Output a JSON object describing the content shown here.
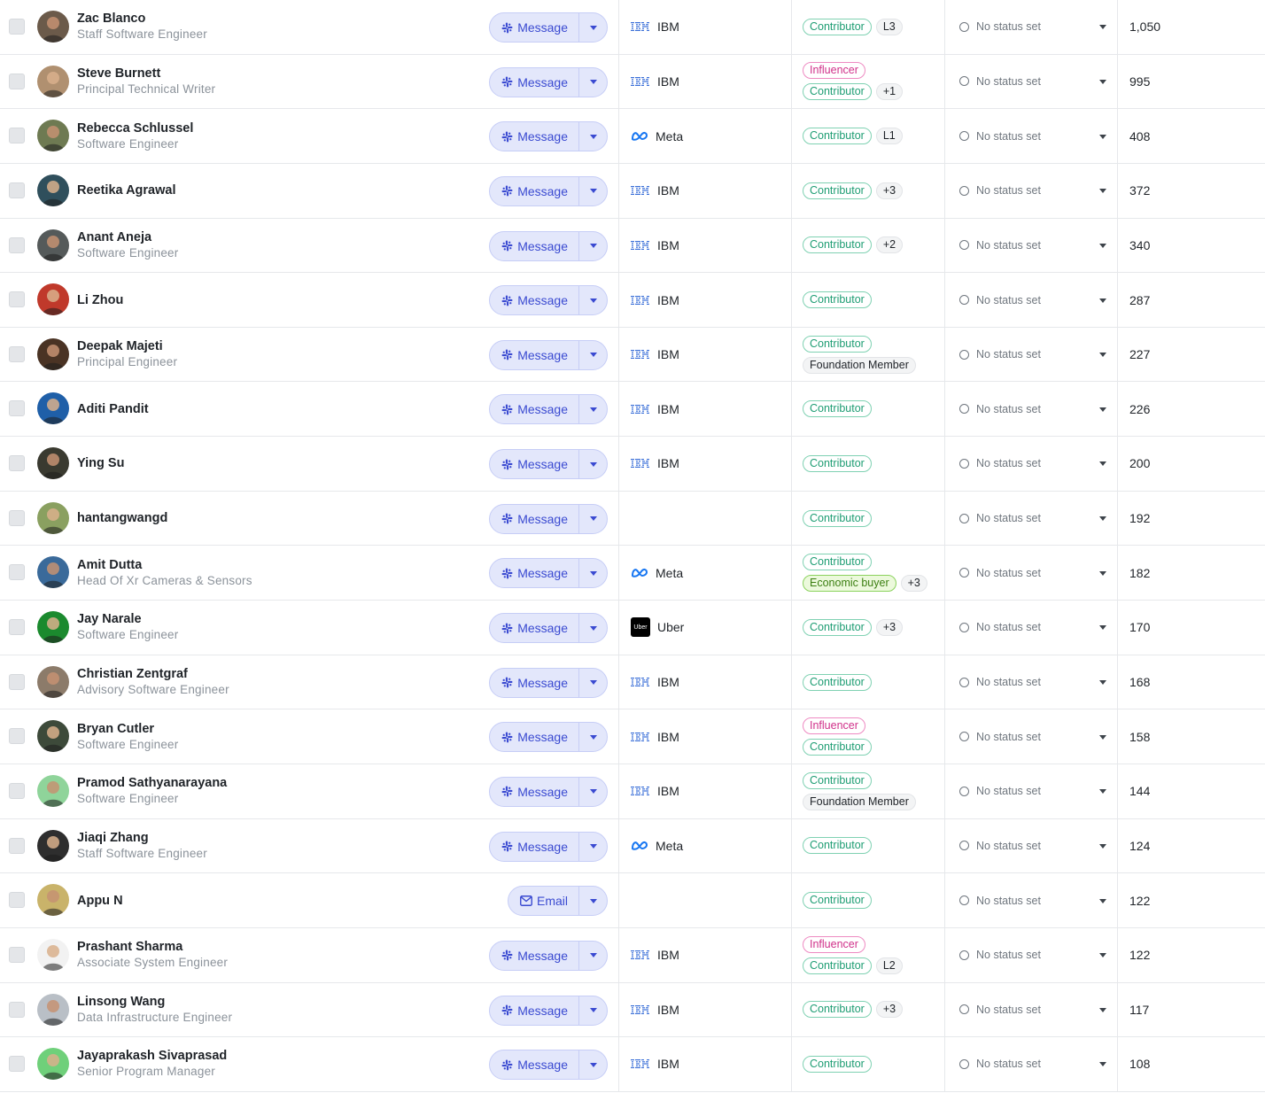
{
  "rows": [
    {
      "name": "Zac Blanco",
      "title": "Staff Software Engineer",
      "action": "Message",
      "company": "IBM",
      "tag_lines": [
        [
          {
            "text": "Contributor",
            "style": "green"
          },
          {
            "text": "L3",
            "style": "gray"
          }
        ]
      ],
      "status": "No status set",
      "score": "1,050",
      "avatar_color": "#6b5a4a"
    },
    {
      "name": "Steve Burnett",
      "title": "Principal Technical Writer",
      "action": "Message",
      "company": "IBM",
      "tag_lines": [
        [
          {
            "text": "Influencer",
            "style": "pink"
          }
        ],
        [
          {
            "text": "Contributor",
            "style": "green"
          },
          {
            "text": "+1",
            "style": "gray"
          }
        ]
      ],
      "status": "No status set",
      "score": "995",
      "avatar_color": "#b09070"
    },
    {
      "name": "Rebecca Schlussel",
      "title": "Software Engineer",
      "action": "Message",
      "company": "Meta",
      "tag_lines": [
        [
          {
            "text": "Contributor",
            "style": "green"
          },
          {
            "text": "L1",
            "style": "gray"
          }
        ]
      ],
      "status": "No status set",
      "score": "408",
      "avatar_color": "#6e7a52"
    },
    {
      "name": "Reetika Agrawal",
      "title": "",
      "action": "Message",
      "company": "IBM",
      "tag_lines": [
        [
          {
            "text": "Contributor",
            "style": "green"
          },
          {
            "text": "+3",
            "style": "gray"
          }
        ]
      ],
      "status": "No status set",
      "score": "372",
      "avatar_color": "#2f4f5c"
    },
    {
      "name": "Anant Aneja",
      "title": "Software Engineer",
      "action": "Message",
      "company": "IBM",
      "tag_lines": [
        [
          {
            "text": "Contributor",
            "style": "green"
          },
          {
            "text": "+2",
            "style": "gray"
          }
        ]
      ],
      "status": "No status set",
      "score": "340",
      "avatar_color": "#555a5a"
    },
    {
      "name": "Li Zhou",
      "title": "",
      "action": "Message",
      "company": "IBM",
      "tag_lines": [
        [
          {
            "text": "Contributor",
            "style": "green"
          }
        ]
      ],
      "status": "No status set",
      "score": "287",
      "avatar_color": "#c0392b"
    },
    {
      "name": "Deepak Majeti",
      "title": "Principal Engineer",
      "action": "Message",
      "company": "IBM",
      "tag_lines": [
        [
          {
            "text": "Contributor",
            "style": "green"
          }
        ],
        [
          {
            "text": "Foundation Member",
            "style": "gray"
          }
        ]
      ],
      "status": "No status set",
      "score": "227",
      "avatar_color": "#4a3324"
    },
    {
      "name": "Aditi Pandit",
      "title": "",
      "action": "Message",
      "company": "IBM",
      "tag_lines": [
        [
          {
            "text": "Contributor",
            "style": "green"
          }
        ]
      ],
      "status": "No status set",
      "score": "226",
      "avatar_color": "#1f5fa8"
    },
    {
      "name": "Ying Su",
      "title": "",
      "action": "Message",
      "company": "IBM",
      "tag_lines": [
        [
          {
            "text": "Contributor",
            "style": "green"
          }
        ]
      ],
      "status": "No status set",
      "score": "200",
      "avatar_color": "#3a3a30"
    },
    {
      "name": "hantangwangd",
      "title": "",
      "action": "Message",
      "company": "",
      "tag_lines": [
        [
          {
            "text": "Contributor",
            "style": "green"
          }
        ]
      ],
      "status": "No status set",
      "score": "192",
      "avatar_color": "#8aa060"
    },
    {
      "name": "Amit Dutta",
      "title": "Head Of Xr Cameras & Sensors",
      "action": "Message",
      "company": "Meta",
      "tag_lines": [
        [
          {
            "text": "Contributor",
            "style": "green"
          }
        ],
        [
          {
            "text": "Economic buyer",
            "style": "lime"
          },
          {
            "text": "+3",
            "style": "gray"
          }
        ]
      ],
      "status": "No status set",
      "score": "182",
      "avatar_color": "#3a6a9a"
    },
    {
      "name": "Jay Narale",
      "title": "Software Engineer",
      "action": "Message",
      "company": "Uber",
      "tag_lines": [
        [
          {
            "text": "Contributor",
            "style": "green"
          },
          {
            "text": "+3",
            "style": "gray"
          }
        ]
      ],
      "status": "No status set",
      "score": "170",
      "avatar_color": "#1b8a2e"
    },
    {
      "name": "Christian Zentgraf",
      "title": "Advisory Software Engineer",
      "action": "Message",
      "company": "IBM",
      "tag_lines": [
        [
          {
            "text": "Contributor",
            "style": "green"
          }
        ]
      ],
      "status": "No status set",
      "score": "168",
      "avatar_color": "#8c7b6a"
    },
    {
      "name": "Bryan Cutler",
      "title": "Software Engineer",
      "action": "Message",
      "company": "IBM",
      "tag_lines": [
        [
          {
            "text": "Influencer",
            "style": "pink"
          }
        ],
        [
          {
            "text": "Contributor",
            "style": "green"
          }
        ]
      ],
      "status": "No status set",
      "score": "158",
      "avatar_color": "#3d4a3a"
    },
    {
      "name": "Pramod Sathyanarayana",
      "title": "Software Engineer",
      "action": "Message",
      "company": "IBM",
      "tag_lines": [
        [
          {
            "text": "Contributor",
            "style": "green"
          }
        ],
        [
          {
            "text": "Foundation Member",
            "style": "gray"
          }
        ]
      ],
      "status": "No status set",
      "score": "144",
      "avatar_color": "#8fd49a"
    },
    {
      "name": "Jiaqi Zhang",
      "title": "Staff Software Engineer",
      "action": "Message",
      "company": "Meta",
      "tag_lines": [
        [
          {
            "text": "Contributor",
            "style": "green"
          }
        ]
      ],
      "status": "No status set",
      "score": "124",
      "avatar_color": "#2e2e2e"
    },
    {
      "name": "Appu N",
      "title": "",
      "action": "Email",
      "company": "",
      "tag_lines": [
        [
          {
            "text": "Contributor",
            "style": "green"
          }
        ]
      ],
      "status": "No status set",
      "score": "122",
      "avatar_color": "#c9b36a"
    },
    {
      "name": "Prashant Sharma",
      "title": "Associate System Engineer",
      "action": "Message",
      "company": "IBM",
      "tag_lines": [
        [
          {
            "text": "Influencer",
            "style": "pink"
          }
        ],
        [
          {
            "text": "Contributor",
            "style": "green"
          },
          {
            "text": "L2",
            "style": "gray"
          }
        ]
      ],
      "status": "No status set",
      "score": "122",
      "avatar_color": "#f2f2f2"
    },
    {
      "name": "Linsong Wang",
      "title": "Data Infrastructure Engineer",
      "action": "Message",
      "company": "IBM",
      "tag_lines": [
        [
          {
            "text": "Contributor",
            "style": "green"
          },
          {
            "text": "+3",
            "style": "gray"
          }
        ]
      ],
      "status": "No status set",
      "score": "117",
      "avatar_color": "#b9bfc6"
    },
    {
      "name": "Jayaprakash Sivaprasad",
      "title": "Senior Program Manager",
      "action": "Message",
      "company": "IBM",
      "tag_lines": [
        [
          {
            "text": "Contributor",
            "style": "green"
          }
        ]
      ],
      "status": "No status set",
      "score": "108",
      "avatar_color": "#6fd07a"
    }
  ],
  "icons": {
    "message": "slack-icon",
    "email": "mail-icon",
    "status": "empty-circle-icon",
    "dropdown": "chevron-down-icon"
  }
}
